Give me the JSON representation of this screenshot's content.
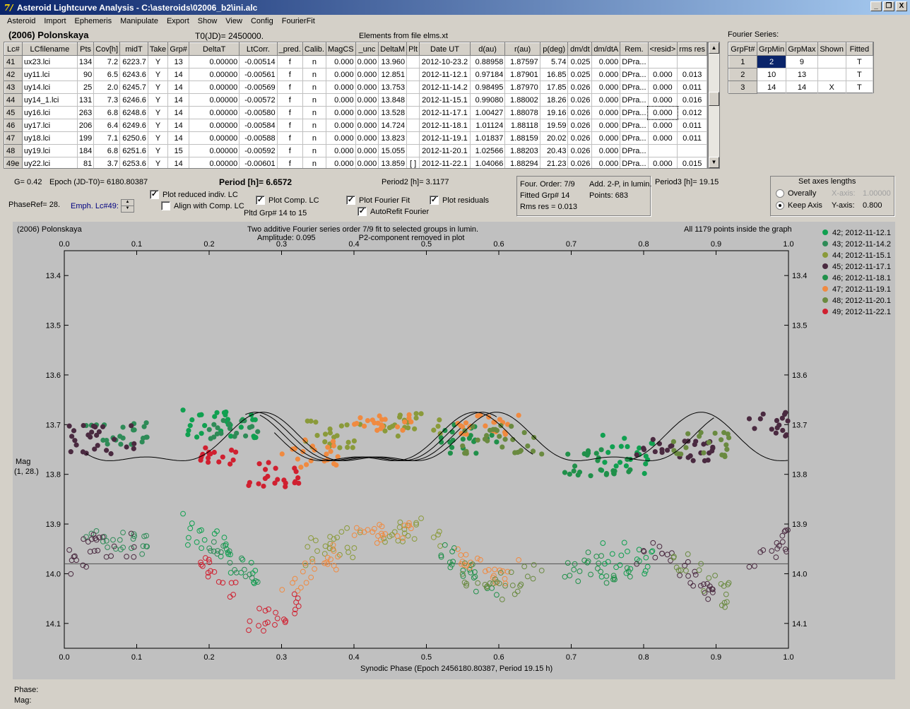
{
  "window": {
    "title": "Asteroid Lightcurve Analysis - C:\\asteroids\\02006_b2\\ini.alc",
    "buttons": {
      "minimize": "_",
      "restore": "❐",
      "close": "X"
    }
  },
  "menu": [
    "Asteroid",
    "Import",
    "Ephemeris",
    "Manipulate",
    "Export",
    "Show",
    "View",
    "Config",
    "FourierFit"
  ],
  "header": {
    "asteroid": "(2006) Polonskaya",
    "t0": "T0(JD)= 2450000.",
    "elements": "Elements from file elms.xt",
    "fourier_label": "Fourier Series:"
  },
  "lc_table": {
    "columns": [
      "Lc#",
      "LCfilename",
      "Pts",
      "Cov[h]",
      "midT",
      "Take",
      "Grp#",
      "DeltaT",
      "LtCorr.",
      "_pred.",
      "Calib.",
      "MagCS",
      "_unc",
      "DeltaM",
      "Plt",
      "Date UT",
      "d(au)",
      "r(au)",
      "p(deg)",
      "dm/dt",
      "dm/dtA",
      "Rem.",
      "<resid>",
      "rms res"
    ],
    "rows": [
      [
        "41",
        "ux23.lci",
        "134",
        "7.2",
        "6223.7",
        "Y",
        "13",
        "0.00000",
        "-0.00514",
        "f",
        "n",
        "0.000",
        "0.000",
        "13.960",
        "",
        "2012-10-23.2",
        "0.88958",
        "1.87597",
        "5.74",
        "0.025",
        "0.000",
        "DPra...",
        "",
        ""
      ],
      [
        "42",
        "uy11.lci",
        "90",
        "6.5",
        "6243.6",
        "Y",
        "14",
        "0.00000",
        "-0.00561",
        "f",
        "n",
        "0.000",
        "0.000",
        "12.851",
        "",
        "2012-11-12.1",
        "0.97184",
        "1.87901",
        "16.85",
        "0.025",
        "0.000",
        "DPra...",
        "0.000",
        "0.013"
      ],
      [
        "43",
        "uy14.lci",
        "25",
        "2.0",
        "6245.7",
        "Y",
        "14",
        "0.00000",
        "-0.00569",
        "f",
        "n",
        "0.000",
        "0.000",
        "13.753",
        "",
        "2012-11-14.2",
        "0.98495",
        "1.87970",
        "17.85",
        "0.026",
        "0.000",
        "DPra...",
        "0.000",
        "0.011"
      ],
      [
        "44",
        "uy14_1.lci",
        "131",
        "7.3",
        "6246.6",
        "Y",
        "14",
        "0.00000",
        "-0.00572",
        "f",
        "n",
        "0.000",
        "0.000",
        "13.848",
        "",
        "2012-11-15.1",
        "0.99080",
        "1.88002",
        "18.26",
        "0.026",
        "0.000",
        "DPra...",
        "0.000",
        "0.016"
      ],
      [
        "45",
        "uy16.lci",
        "263",
        "6.8",
        "6248.6",
        "Y",
        "14",
        "0.00000",
        "-0.00580",
        "f",
        "n",
        "0.000",
        "0.000",
        "13.528",
        "",
        "2012-11-17.1",
        "1.00427",
        "1.88078",
        "19.16",
        "0.026",
        "0.000",
        "DPra...",
        "0.000",
        "0.012"
      ],
      [
        "46",
        "uy17.lci",
        "206",
        "6.4",
        "6249.6",
        "Y",
        "14",
        "0.00000",
        "-0.00584",
        "f",
        "n",
        "0.000",
        "0.000",
        "14.724",
        "",
        "2012-11-18.1",
        "1.01124",
        "1.88118",
        "19.59",
        "0.026",
        "0.000",
        "DPra...",
        "0.000",
        "0.011"
      ],
      [
        "47",
        "uy18.lci",
        "199",
        "7.1",
        "6250.6",
        "Y",
        "14",
        "0.00000",
        "-0.00588",
        "f",
        "n",
        "0.000",
        "0.000",
        "13.823",
        "",
        "2012-11-19.1",
        "1.01837",
        "1.88159",
        "20.02",
        "0.026",
        "0.000",
        "DPra...",
        "0.000",
        "0.011"
      ],
      [
        "48",
        "uy19.lci",
        "184",
        "6.8",
        "6251.6",
        "Y",
        "15",
        "0.00000",
        "-0.00592",
        "f",
        "n",
        "0.000",
        "0.000",
        "15.055",
        "",
        "2012-11-20.1",
        "1.02566",
        "1.88203",
        "20.43",
        "0.026",
        "0.000",
        "DPra...",
        "",
        ""
      ],
      [
        "49e",
        "uy22.lci",
        "81",
        "3.7",
        "6253.6",
        "Y",
        "14",
        "0.00000",
        "-0.00601",
        "f",
        "n",
        "0.000",
        "0.000",
        "13.859",
        "[ ]",
        "2012-11-22.1",
        "1.04066",
        "1.88294",
        "21.23",
        "0.026",
        "0.000",
        "DPra...",
        "0.000",
        "0.015"
      ]
    ]
  },
  "fourier_table": {
    "columns": [
      "GrpFt#",
      "GrpMin",
      "GrpMax",
      "Shown",
      "Fitted"
    ],
    "rows": [
      [
        "1",
        "2",
        "9",
        "",
        "T"
      ],
      [
        "2",
        "10",
        "13",
        "",
        "T"
      ],
      [
        "3",
        "14",
        "14",
        "X",
        "T"
      ]
    ]
  },
  "controls": {
    "g": "G= 0.42",
    "epoch": "Epoch (JD-T0)= 6180.80387",
    "period": "Period [h]= 6.6572",
    "period2": "Period2 [h]= 3.1177",
    "period3": "Period3 [h]= 19.15",
    "phaseref": "PhaseRef= 28.",
    "emph": "Emph. Lc#49:",
    "plot_reduced": "Plot reduced indiv. LC",
    "align": "Align with Comp. LC",
    "plot_comp": "Plot Comp. LC",
    "pltd_grp": "Pltd Grp#  14 to   15",
    "plot_fourier": "Plot Fourier Fit",
    "autorefit": "AutoRefit Fourier",
    "plot_resid": "Plot residuals",
    "fit_info": {
      "order": "Four. Order:  7/9",
      "add": "Add. 2-P, in lumin.",
      "fitted": "Fitted Grp# 14",
      "points": "Points: 683",
      "rms": "Rms res     = 0.013"
    },
    "axes": {
      "title": "Set axes lengths",
      "overally": "Overally",
      "keep": "Keep Axis",
      "xaxis_label": "X-axis:",
      "xaxis_value": "1.00000",
      "yaxis_label": "Y-axis:",
      "yaxis_value": "0.800"
    }
  },
  "chart_data": {
    "type": "scatter",
    "title": "Two additive Fourier series order 7/9 fit to selected groups in lumin.",
    "subtitle": "Amplitude: 0.095                    P2-component removed in plot",
    "corner_left": "(2006) Polonskaya",
    "corner_right": "All 1179 points inside the graph",
    "xlabel": "Synodic Phase (Epoch 2456180.80387, Period 19.15 h)",
    "ylabel": "Mag",
    "ylabel2": "(1, 28.)",
    "xlim": [
      0.0,
      1.0
    ],
    "ylim": [
      13.35,
      14.15
    ],
    "y_inverted": true,
    "x_ticks": [
      "0.0",
      "0.1",
      "0.2",
      "0.3",
      "0.4",
      "0.5",
      "0.6",
      "0.7",
      "0.8",
      "0.9",
      "1.0"
    ],
    "y_ticks": [
      "13.4",
      "13.5",
      "13.6",
      "13.7",
      "13.8",
      "13.9",
      "14.0",
      "14.1"
    ],
    "residual_baseline": 13.98,
    "legend_position": "right",
    "series": [
      {
        "name": "42; 2012-11-12.1",
        "color": "#10a050",
        "ranges": [
          [
            0.16,
            0.27,
            13.7,
            0.03
          ],
          [
            0.74,
            0.82,
            13.76,
            0.04
          ]
        ]
      },
      {
        "name": "43; 2012-11-14.2",
        "color": "#2e8b57",
        "ranges": [
          [
            0.03,
            0.12,
            13.72,
            0.025
          ],
          [
            0.2,
            0.27,
            13.71,
            0.02
          ]
        ]
      },
      {
        "name": "44; 2012-11-15.1",
        "color": "#8a9a3a",
        "ranges": [
          [
            0.33,
            0.42,
            13.72,
            0.03
          ],
          [
            0.44,
            0.52,
            13.7,
            0.025
          ]
        ]
      },
      {
        "name": "45; 2012-11-17.1",
        "color": "#4a2a40",
        "ranges": [
          [
            0.0,
            0.1,
            13.73,
            0.03
          ],
          [
            0.79,
            0.9,
            13.75,
            0.025
          ],
          [
            0.94,
            1.0,
            13.7,
            0.025
          ]
        ]
      },
      {
        "name": "46; 2012-11-18.1",
        "color": "#20904a",
        "ranges": [
          [
            0.52,
            0.6,
            13.73,
            0.03
          ],
          [
            0.69,
            0.79,
            13.78,
            0.03
          ]
        ]
      },
      {
        "name": "47; 2012-11-19.1",
        "color": "#f08a40",
        "ranges": [
          [
            0.3,
            0.38,
            13.76,
            0.03
          ],
          [
            0.4,
            0.48,
            13.7,
            0.02
          ],
          [
            0.54,
            0.63,
            13.7,
            0.02
          ]
        ]
      },
      {
        "name": "48; 2012-11-20.1",
        "color": "#6a8a40",
        "ranges": [
          [
            0.55,
            0.66,
            13.73,
            0.03
          ],
          [
            0.84,
            0.92,
            13.74,
            0.025
          ]
        ]
      },
      {
        "name": "49; 2012-11-22.1",
        "color": "#d02030",
        "ranges": [
          [
            0.18,
            0.24,
            13.76,
            0.02
          ],
          [
            0.25,
            0.33,
            13.8,
            0.025
          ]
        ]
      }
    ]
  },
  "status": {
    "phase": "Phase:",
    "mag": "Mag:"
  }
}
